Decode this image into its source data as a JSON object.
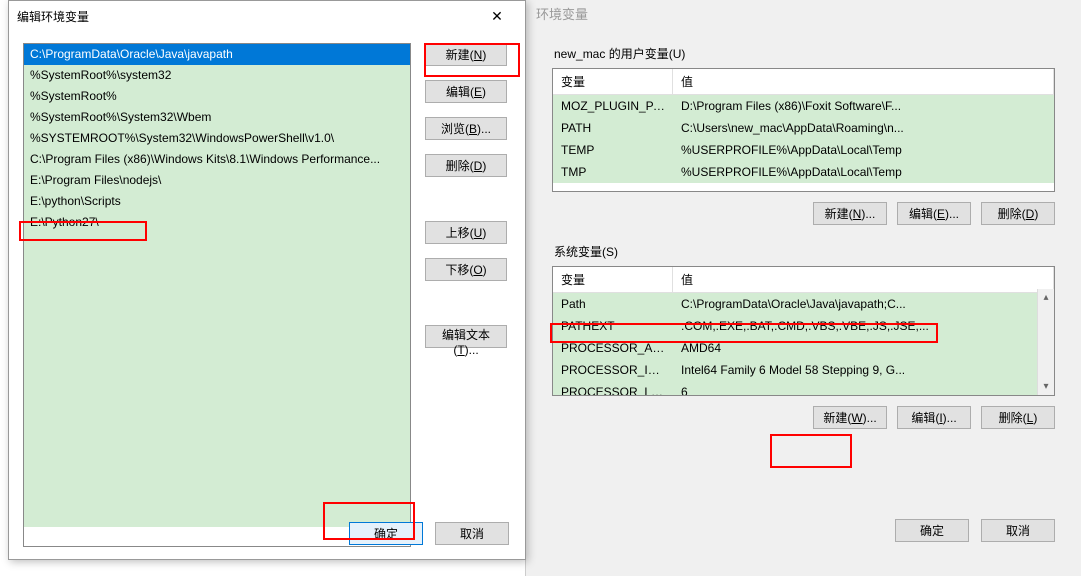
{
  "dialog": {
    "title": "编辑环境变量",
    "close_glyph": "✕",
    "paths": [
      "C:\\ProgramData\\Oracle\\Java\\javapath",
      "%SystemRoot%\\system32",
      "%SystemRoot%",
      "%SystemRoot%\\System32\\Wbem",
      "%SYSTEMROOT%\\System32\\WindowsPowerShell\\v1.0\\",
      "C:\\Program Files (x86)\\Windows Kits\\8.1\\Windows Performance...",
      "E:\\Program Files\\nodejs\\",
      "E:\\python\\Scripts",
      "E:\\Python27\\"
    ],
    "selected_index": 0,
    "buttons": {
      "new": "新建(N)",
      "edit": "编辑(E)",
      "browse": "浏览(B)...",
      "delete": "删除(D)",
      "moveup": "上移(U)",
      "movedown": "下移(O)",
      "edittext": "编辑文本(T)...",
      "ok": "确定",
      "cancel": "取消"
    }
  },
  "bg": {
    "title": "环境变量",
    "user_section": "new_mac 的用户变量(U)",
    "sys_section": "系统变量(S)",
    "cols": {
      "name": "变量",
      "value": "值"
    },
    "user_vars": [
      {
        "name": "MOZ_PLUGIN_PA...",
        "value": "D:\\Program Files (x86)\\Foxit Software\\F..."
      },
      {
        "name": "PATH",
        "value": "C:\\Users\\new_mac\\AppData\\Roaming\\n..."
      },
      {
        "name": "TEMP",
        "value": "%USERPROFILE%\\AppData\\Local\\Temp"
      },
      {
        "name": "TMP",
        "value": "%USERPROFILE%\\AppData\\Local\\Temp"
      }
    ],
    "sys_vars": [
      {
        "name": "Path",
        "value": "C:\\ProgramData\\Oracle\\Java\\javapath;C..."
      },
      {
        "name": "PATHEXT",
        "value": ".COM;.EXE;.BAT;.CMD;.VBS;.VBE;.JS;.JSE;..."
      },
      {
        "name": "PROCESSOR_AR...",
        "value": "AMD64"
      },
      {
        "name": "PROCESSOR_IDE...",
        "value": "Intel64 Family 6 Model 58 Stepping 9, G..."
      },
      {
        "name": "PROCESSOR_LEV...",
        "value": "6"
      }
    ],
    "buttons": {
      "new_user": "新建(N)...",
      "edit_user": "编辑(E)...",
      "delete_user": "删除(D)",
      "new_sys": "新建(W)...",
      "edit_sys": "编辑(I)...",
      "delete_sys": "删除(L)",
      "ok": "确定",
      "cancel": "取消"
    }
  }
}
